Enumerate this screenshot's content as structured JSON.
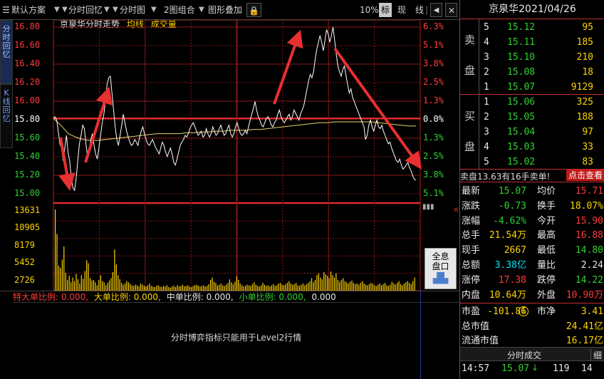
{
  "toolbar": {
    "scheme": "默认方案",
    "fenshi_huiyi": "分时回忆",
    "fenshitu": "分时图",
    "combo": "2图组合",
    "overlay": "图形叠加",
    "pct": "10%",
    "biao": "标",
    "xian": "现",
    "xian2": "线"
  },
  "side": {
    "tab1": "分时回忆",
    "tab2": "K线回忆"
  },
  "chart_title": {
    "name": "京泉华分时走势",
    "avg": "均线",
    "vol": "成交量"
  },
  "price_labels": [
    "16.80",
    "16.60",
    "16.40",
    "16.20",
    "16.00",
    "15.80",
    "15.60",
    "15.40",
    "15.20",
    "15.00"
  ],
  "pct_labels": [
    "6.3%",
    "5.1%",
    "3.8%",
    "2.5%",
    "1.3%",
    "0.0%",
    "1.3%",
    "2.5%",
    "3.8%",
    "5.1%"
  ],
  "vol_labels": [
    "13631",
    "10905",
    "8179",
    "5452",
    "2726"
  ],
  "ratio_bar": {
    "big1": "特大单比例: 0.000,",
    "big2": "大单比例: 0.000,",
    "mid": "中单比例: 0.000,",
    "small": "小单比例: 0.000,",
    "tail": "0.000"
  },
  "level2_msg": "分时博弈指标只能用于Level2行情",
  "quick_btn": {
    "l1": "全息",
    "l2": "盘口"
  },
  "quote": {
    "title": "京泉华2021/04/26",
    "sell_label1": "卖",
    "sell_label2": "盘",
    "buy_label1": "买",
    "buy_label2": "盘",
    "asks": [
      [
        "5",
        "15.12",
        "95"
      ],
      [
        "4",
        "15.11",
        "185"
      ],
      [
        "3",
        "15.10",
        "210"
      ],
      [
        "2",
        "15.08",
        "18"
      ],
      [
        "1",
        "15.07",
        "9129"
      ]
    ],
    "bids": [
      [
        "1",
        "15.06",
        "325"
      ],
      [
        "2",
        "15.05",
        "188"
      ],
      [
        "3",
        "15.04",
        "97"
      ],
      [
        "4",
        "15.03",
        "33"
      ],
      [
        "5",
        "15.02",
        "83"
      ]
    ],
    "alert": "卖盘13.63有16手卖单!",
    "alert_btn": "点击查看",
    "stats": [
      [
        "最新",
        "15.07",
        "均价",
        "15.71"
      ],
      [
        "涨跌",
        "-0.73",
        "换手",
        "18.07%"
      ],
      [
        "涨幅",
        "-4.62%",
        "今开",
        "15.90"
      ],
      [
        "总手",
        "21.54万",
        "最高",
        "16.88"
      ],
      [
        "现手",
        "2667",
        "最低",
        "14.80"
      ],
      [
        "总额",
        "3.38亿",
        "量比",
        "2.24"
      ],
      [
        "涨停",
        "17.38",
        "跌停",
        "14.22"
      ],
      [
        "内盘",
        "10.64万",
        "外盘",
        "10.90万"
      ]
    ],
    "val": [
      [
        "市盈",
        "-101.86",
        "市净",
        "3.41"
      ],
      [
        "总市值",
        "",
        "",
        "24.41亿"
      ],
      [
        "流通市值",
        "",
        "",
        "16.17亿"
      ]
    ],
    "tick_header": "分时成交",
    "tick_side": "细",
    "tick": {
      "time": "14:57",
      "price": "15.07",
      "qty": "119",
      "n": "14"
    }
  },
  "chart_data": {
    "type": "line",
    "ylim": [
      14.8,
      16.88
    ],
    "prev_close": 15.8,
    "price": [
      15.8,
      15.82,
      15.78,
      15.65,
      15.5,
      15.45,
      15.3,
      15.45,
      15.6,
      15.4,
      15.3,
      15.1,
      14.98,
      14.95,
      15.1,
      15.3,
      15.5,
      15.6,
      15.72,
      15.68,
      15.5,
      15.35,
      15.42,
      15.55,
      15.62,
      15.48,
      15.38,
      15.32,
      15.45,
      15.6,
      15.75,
      15.85,
      16.0,
      16.2,
      16.28,
      16.3,
      16.1,
      15.9,
      15.7,
      15.55,
      15.48,
      15.6,
      15.72,
      15.85,
      15.75,
      15.65,
      15.58,
      15.52,
      15.48,
      15.5,
      15.55,
      15.52,
      15.48,
      15.58,
      15.65,
      15.7,
      15.62,
      15.55,
      15.5,
      15.48,
      15.52,
      15.55,
      15.5,
      15.45,
      15.42,
      15.38,
      15.45,
      15.52,
      15.48,
      15.4,
      15.35,
      15.4,
      15.45,
      15.38,
      15.28,
      15.25,
      15.32,
      15.4,
      15.48,
      15.52,
      15.55,
      15.6,
      15.58,
      15.62,
      15.68,
      15.72,
      15.75,
      15.7,
      15.65,
      15.6,
      15.62,
      15.65,
      15.58,
      15.6,
      15.68,
      15.62,
      15.58,
      15.62,
      15.7,
      15.65,
      15.6,
      15.62,
      15.68,
      15.72,
      15.65,
      15.6,
      15.62,
      15.68,
      15.72,
      15.62,
      15.58,
      15.62,
      15.7,
      15.75,
      15.68,
      15.62,
      15.6,
      15.62,
      15.66,
      15.62,
      15.7,
      15.78,
      15.85,
      15.92,
      16.0,
      15.9,
      15.82,
      15.78,
      15.72,
      15.7,
      15.75,
      15.8,
      15.82,
      15.78,
      15.72,
      15.7,
      15.75,
      15.78,
      15.85,
      15.9,
      15.82,
      15.78,
      15.75,
      15.78,
      15.82,
      15.85,
      15.78,
      15.82,
      15.9,
      15.86,
      15.82,
      15.78,
      15.85,
      15.9,
      15.95,
      16.05,
      16.15,
      16.25,
      16.32,
      16.28,
      16.35,
      16.5,
      16.62,
      16.7,
      16.78,
      16.7,
      16.6,
      16.72,
      16.85,
      16.8,
      16.7,
      16.78,
      16.88,
      16.72,
      16.55,
      16.42,
      16.35,
      16.3,
      16.38,
      16.42,
      16.3,
      16.2,
      16.1,
      16.15,
      16.05,
      16.0,
      15.95,
      15.9,
      15.85,
      15.8,
      15.75,
      15.7,
      15.55,
      15.6,
      15.72,
      15.78,
      15.7,
      15.65,
      15.72,
      15.78,
      15.7,
      15.68,
      15.72,
      15.65,
      15.6,
      15.55,
      15.5,
      15.52,
      15.45,
      15.4,
      15.35,
      15.3,
      15.28,
      15.32,
      15.25,
      15.2,
      15.22,
      15.25,
      15.28,
      15.22,
      15.18,
      15.12,
      15.08,
      15.07
    ],
    "avg": [
      15.8,
      15.72,
      15.62,
      15.58,
      15.55,
      15.54,
      15.54,
      15.55,
      15.56,
      15.57,
      15.58,
      15.59,
      15.6,
      15.61,
      15.62,
      15.62,
      15.62,
      15.62,
      15.63,
      15.63,
      15.64,
      15.64,
      15.65,
      15.65,
      15.66,
      15.66,
      15.66,
      15.67,
      15.67,
      15.68,
      15.69,
      15.7,
      15.71,
      15.72,
      15.73,
      15.74,
      15.75,
      15.75,
      15.76,
      15.76,
      15.76,
      15.76,
      15.76,
      15.76,
      15.75,
      15.74,
      15.73,
      15.72,
      15.71,
      15.71
    ],
    "volume": [
      13631,
      9500,
      4200,
      3800,
      5200,
      7400,
      3000,
      1800,
      2500,
      1400,
      2200,
      1600,
      2800,
      1900,
      1200,
      2600,
      2000,
      3300,
      5100,
      4600,
      2100,
      1700,
      1800,
      1400,
      900,
      1800,
      2600,
      1600,
      1400,
      900,
      1300,
      1700,
      2100,
      3100,
      6900,
      4400,
      2600,
      1900,
      1300,
      1000,
      1200,
      1600,
      1400,
      1100,
      900,
      800,
      1000,
      900,
      700,
      1200,
      1000,
      800,
      700,
      900,
      1200,
      800,
      700,
      600,
      800,
      900,
      700,
      600,
      800,
      700,
      900,
      600,
      500,
      700,
      800,
      600,
      900,
      700,
      800,
      1000,
      700,
      800,
      900,
      700,
      600,
      800,
      900,
      1000,
      800,
      700,
      800,
      900,
      700,
      800,
      1100,
      1800,
      2200,
      1500,
      1300,
      900,
      1000,
      1200,
      900,
      800,
      1000,
      1300,
      1900,
      1400,
      1100,
      1500,
      2400,
      1800,
      1200,
      900,
      700,
      800,
      1000,
      900,
      800,
      1100,
      1400,
      1000,
      800,
      700,
      900,
      1300,
      1000,
      800,
      900,
      700,
      900,
      1100,
      800,
      900,
      1200,
      1300,
      1000,
      900,
      1100,
      1300,
      1600,
      1200,
      1000,
      1100,
      1300,
      900,
      800,
      1000,
      1200,
      900,
      1100,
      1300,
      1600,
      2100,
      1400,
      1800,
      2600,
      2900,
      2200,
      1900,
      3100,
      2700,
      2500,
      2100,
      3200,
      2600,
      2200,
      2900,
      1800,
      1500,
      1800,
      2100,
      1600,
      1400,
      1200,
      1500,
      1700,
      1300,
      1100,
      1200,
      1000,
      1300,
      1600,
      1200,
      1000,
      900,
      1100,
      1300,
      1200,
      900,
      800,
      1000,
      1200,
      900,
      1100,
      1300,
      900,
      800,
      1000,
      1500,
      1200,
      1000,
      1300,
      1600,
      1100,
      900,
      1200,
      1400,
      1600,
      1300,
      1100,
      1600,
      2200
    ],
    "vol_ylim": [
      0,
      13631
    ]
  }
}
